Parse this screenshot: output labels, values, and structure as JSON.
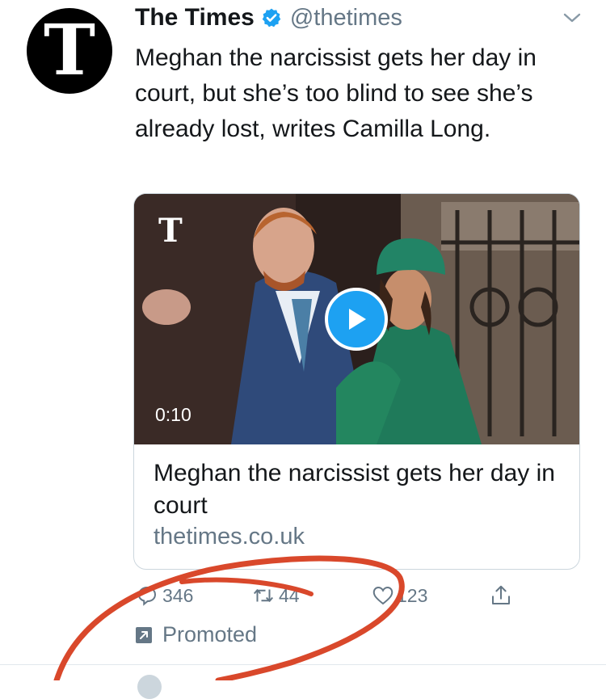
{
  "tweet": {
    "author_name": "The Times",
    "avatar_letter": "T",
    "handle": "@thetimes",
    "text": "Meghan the narcissist gets her day in court, but she’s too blind to see she’s already lost, writes Camilla Long."
  },
  "card": {
    "logo_letter": "T",
    "duration": "0:10",
    "title": "Meghan the narcissist gets her day in court",
    "domain": "thetimes.co.uk"
  },
  "actions": {
    "replies": "346",
    "retweets": "44",
    "likes": "123"
  },
  "promoted_label": "Promoted",
  "colors": {
    "verified_blue": "#1da1f2",
    "secondary_text": "#657786",
    "annotation_red": "#d9482b"
  },
  "icons": [
    "verified-badge-icon",
    "chevron-down-icon",
    "play-icon",
    "reply-icon",
    "retweet-icon",
    "like-icon",
    "share-icon",
    "promoted-icon"
  ]
}
